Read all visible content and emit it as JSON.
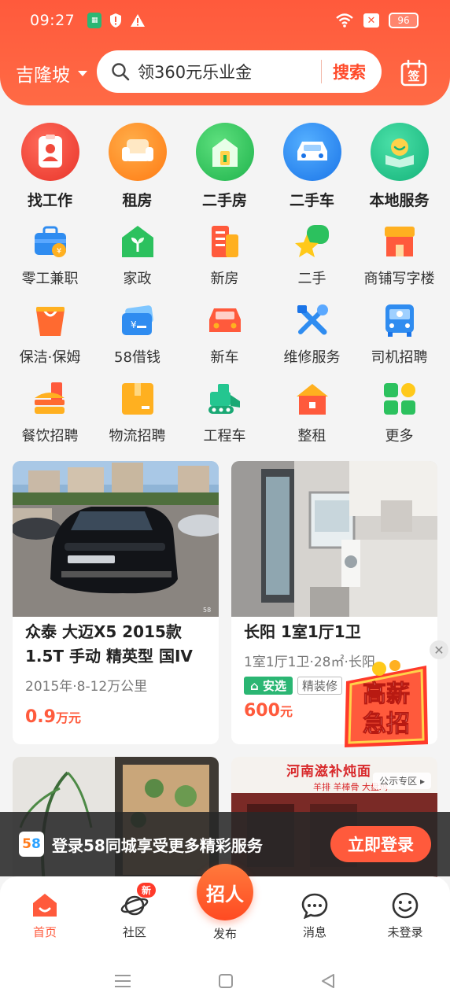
{
  "status_bar": {
    "time": "09:27",
    "battery": "96"
  },
  "header": {
    "city": "吉隆坡",
    "search_placeholder": "领360元乐业金",
    "search_button": "搜索",
    "sign_label": "签"
  },
  "main_categories": [
    {
      "label": "找工作",
      "icon": "resume-icon",
      "color": "#f04a3c"
    },
    {
      "label": "租房",
      "icon": "sofa-icon",
      "color": "#ff8a1e"
    },
    {
      "label": "二手房",
      "icon": "house-icon",
      "color": "#2cc15e"
    },
    {
      "label": "二手车",
      "icon": "car-icon",
      "color": "#2f8cf0"
    },
    {
      "label": "本地服务",
      "icon": "map-pin-icon",
      "color": "#24c690"
    }
  ],
  "sub_categories": [
    [
      {
        "label": "零工兼职",
        "icon": "briefcase-icon"
      },
      {
        "label": "家政",
        "icon": "home-sprout-icon"
      },
      {
        "label": "新房",
        "icon": "building-icon"
      },
      {
        "label": "二手",
        "icon": "star-bubble-icon"
      },
      {
        "label": "商铺写字楼",
        "icon": "shop-icon"
      }
    ],
    [
      {
        "label": "保洁·保姆",
        "icon": "bucket-icon"
      },
      {
        "label": "58借钱",
        "icon": "wallet-card-icon"
      },
      {
        "label": "新车",
        "icon": "new-car-icon"
      },
      {
        "label": "维修服务",
        "icon": "tools-icon"
      },
      {
        "label": "司机招聘",
        "icon": "bus-icon"
      }
    ],
    [
      {
        "label": "餐饮招聘",
        "icon": "burger-icon"
      },
      {
        "label": "物流招聘",
        "icon": "package-icon"
      },
      {
        "label": "工程车",
        "icon": "bulldozer-icon"
      },
      {
        "label": "整租",
        "icon": "house-rent-icon"
      },
      {
        "label": "更多",
        "icon": "grid-more-icon"
      }
    ]
  ],
  "feed": [
    {
      "title": "众泰 大迈X5 2015款 1.5T 手动 精英型 国IV",
      "subtitle": "2015年·8-12万公里",
      "price": "0.9",
      "price_unit": "万元"
    },
    {
      "title": "长阳 1室1厅1卫",
      "subtitle": "1室1厅1卫·28㎡·长阳",
      "tags": [
        "安选",
        "精装修"
      ],
      "price": "600",
      "price_unit": "元"
    },
    {
      "ad_label": "公示专区 ▸",
      "shop_sign": "河南滋补炖面",
      "shop_subline": "羊排 羊棒骨 大盘鸡"
    }
  ],
  "promo": {
    "line1": "高薪",
    "line2": "急招"
  },
  "login_banner": {
    "logo": "58",
    "message": "登录58同城享受更多精彩服务",
    "button": "立即登录"
  },
  "bottom_nav": {
    "home": "首页",
    "community": "社区",
    "community_badge": "新",
    "publish_button": "招人",
    "publish": "发布",
    "messages": "消息",
    "profile": "未登录"
  },
  "colors": {
    "accent": "#ff5a3c",
    "active_tab": "#ff5a3c"
  }
}
